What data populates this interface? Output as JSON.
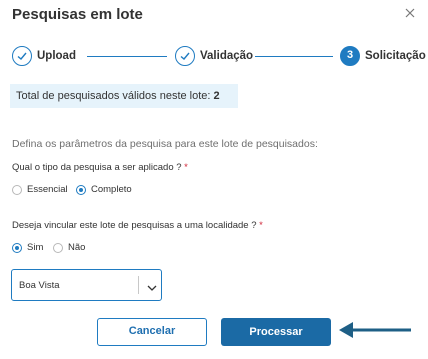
{
  "dialog": {
    "title": "Pesquisas em lote"
  },
  "stepper": {
    "steps": [
      {
        "label": "Upload",
        "status": "completed"
      },
      {
        "label": "Validação",
        "status": "completed"
      },
      {
        "label": "Solicitação",
        "status": "active",
        "number": "3"
      }
    ]
  },
  "info": {
    "text": "Total de pesquisados válidos neste lote:",
    "count": "2"
  },
  "form": {
    "section_text": "Defina os parâmetros da pesquisa para este lote de pesquisados:",
    "question1": {
      "label": "Qual o tipo da pesquisa a ser aplicado ?",
      "required_mark": "*",
      "options": [
        "Essencial",
        "Completo"
      ],
      "selected": "Completo"
    },
    "question2": {
      "label": "Deseja vincular este lote de pesquisas a uma localidade ?",
      "required_mark": "*",
      "options": [
        "Sim",
        "Não"
      ],
      "selected": "Sim"
    },
    "location_select": {
      "value": "Boa Vista"
    }
  },
  "actions": {
    "cancel_label": "Cancelar",
    "process_label": "Processar"
  },
  "colors": {
    "primary": "#1f7bc1",
    "primary_dark": "#1b6aa5",
    "info_bg": "#e6f3fb",
    "required": "#d0273a",
    "arrow": "#1e5f86"
  },
  "icons": {
    "close": "close-icon",
    "step_done": "check-icon",
    "select": "chevron-down-icon",
    "annotation": "arrow-left-icon"
  }
}
